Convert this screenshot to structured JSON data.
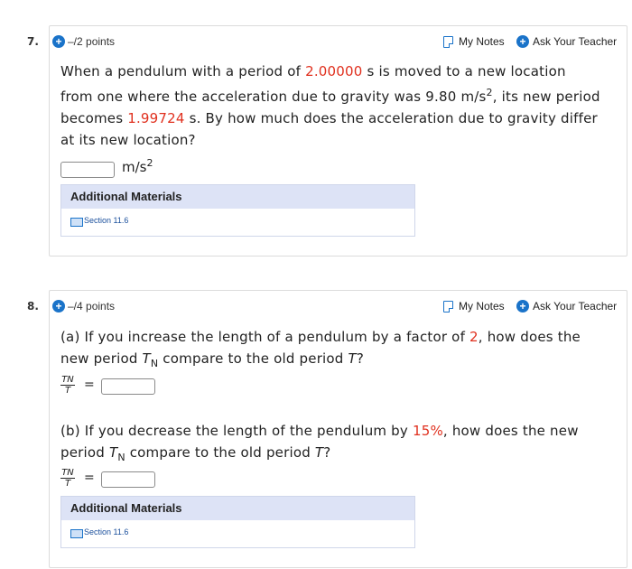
{
  "q7": {
    "number": "7.",
    "points": "–/2 points",
    "my_notes": "My Notes",
    "ask_teacher": "Ask Your Teacher",
    "text_1": "When a pendulum with a period of ",
    "value_1": "2.00000",
    "text_2": " s is moved to a new location from one where the acceleration due to gravity was 9.80 m/s",
    "sup_2": "2",
    "text_3": ", its new period becomes ",
    "value_2": "1.99724",
    "text_4": " s. By how much does the acceleration due to gravity differ at its new location?",
    "unit": "m/s",
    "unit_sup": "2",
    "answer_value": "",
    "additional_materials": "Additional Materials",
    "section_link": "Section 11.6"
  },
  "q8": {
    "number": "8.",
    "points": "–/4 points",
    "my_notes": "My Notes",
    "ask_teacher": "Ask Your Teacher",
    "a_1": "(a) If you increase the length of a pendulum by a factor of ",
    "a_value": "2",
    "a_2": ", how does the new period ",
    "a_T": "T",
    "a_N": "N",
    "a_3": " compare to the old period ",
    "a_T2": "T",
    "a_4": "?",
    "frac_num": "TN",
    "frac_den": "T",
    "eq": "=",
    "b_1": "(b) If you decrease the length of the pendulum by ",
    "b_value": "15%",
    "b_2": ", how does the new period ",
    "b_T": "T",
    "b_N": "N",
    "b_3": " compare to the old period ",
    "b_T2": "T",
    "b_4": "?",
    "additional_materials": "Additional Materials",
    "section_link": "Section 11.6"
  },
  "colors": {
    "accent": "#1a73c9",
    "highlight": "#e0301e",
    "materials_header": "#dde3f6"
  }
}
